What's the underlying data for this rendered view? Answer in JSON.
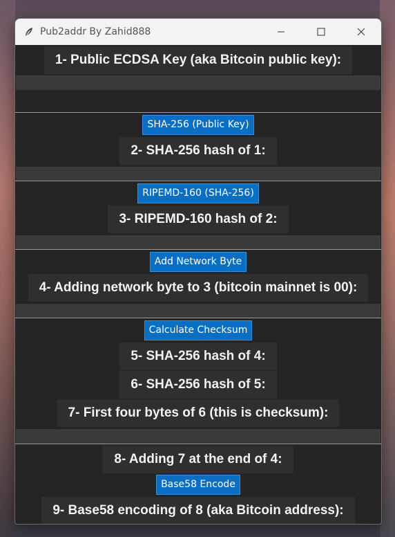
{
  "window": {
    "title": "Pub2addr By Zahid888"
  },
  "sections": {
    "s1": {
      "label": "1- Public ECDSA Key (aka Bitcoin public key):",
      "value": ""
    },
    "s2": {
      "button": "SHA-256 (Public Key)",
      "label": "2- SHA-256 hash of 1:",
      "value": ""
    },
    "s3": {
      "button": "RIPEMD-160 (SHA-256)",
      "label": "3- RIPEMD-160 hash of 2:",
      "value": ""
    },
    "s4": {
      "button": "Add Network Byte",
      "label": "4- Adding network byte to 3 (bitcoin mainnet is 00):",
      "value": ""
    },
    "s5": {
      "button": "Calculate Checksum",
      "label5": "5- SHA-256 hash of 4:",
      "label6": "6- SHA-256 hash of 5:",
      "label7": "7- First four bytes of 6 (this is checksum):",
      "value": ""
    },
    "s8": {
      "label8": "8- Adding 7 at the end of 4:",
      "button": "Base58 Encode",
      "label9": "9- Base58 encoding of 8 (aka Bitcoin address):",
      "value": ""
    }
  }
}
